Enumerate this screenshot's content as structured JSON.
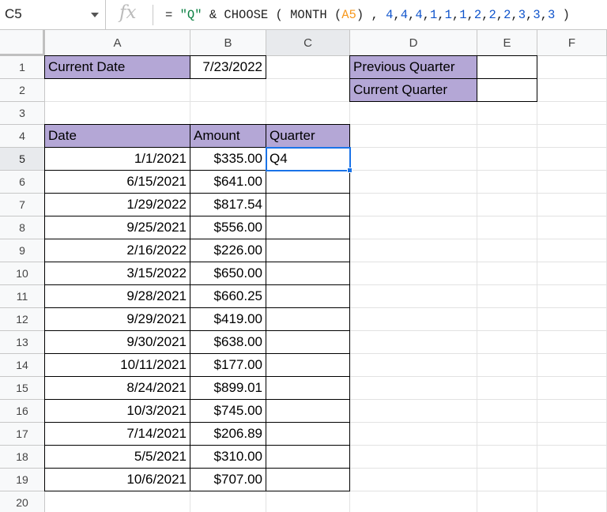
{
  "name_box": "C5",
  "formula_parts": [
    {
      "t": "= ",
      "c": ""
    },
    {
      "t": "\"Q\"",
      "c": "f-str"
    },
    {
      "t": " & CHOOSE ( MONTH (",
      "c": ""
    },
    {
      "t": "A5",
      "c": "f-ref"
    },
    {
      "t": ") , ",
      "c": ""
    },
    {
      "t": "4",
      "c": "f-num"
    },
    {
      "t": ",",
      "c": ""
    },
    {
      "t": "4",
      "c": "f-num"
    },
    {
      "t": ",",
      "c": ""
    },
    {
      "t": "4",
      "c": "f-num"
    },
    {
      "t": ",",
      "c": ""
    },
    {
      "t": "1",
      "c": "f-num"
    },
    {
      "t": ",",
      "c": ""
    },
    {
      "t": "1",
      "c": "f-num"
    },
    {
      "t": ",",
      "c": ""
    },
    {
      "t": "1",
      "c": "f-num"
    },
    {
      "t": ",",
      "c": ""
    },
    {
      "t": "2",
      "c": "f-num"
    },
    {
      "t": ",",
      "c": ""
    },
    {
      "t": "2",
      "c": "f-num"
    },
    {
      "t": ",",
      "c": ""
    },
    {
      "t": "2",
      "c": "f-num"
    },
    {
      "t": ",",
      "c": ""
    },
    {
      "t": "3",
      "c": "f-num"
    },
    {
      "t": ",",
      "c": ""
    },
    {
      "t": "3",
      "c": "f-num"
    },
    {
      "t": ",",
      "c": ""
    },
    {
      "t": "3",
      "c": "f-num"
    },
    {
      "t": " )",
      "c": ""
    }
  ],
  "columns": [
    "A",
    "B",
    "C",
    "D",
    "E",
    "F"
  ],
  "row_numbers": [
    "1",
    "2",
    "3",
    "4",
    "5",
    "6",
    "7",
    "8",
    "9",
    "10",
    "11",
    "12",
    "13",
    "14",
    "15",
    "16",
    "17",
    "18",
    "19",
    "20"
  ],
  "selected_column": "C",
  "selected_row": "5",
  "labels": {
    "current_date_label": "Current Date",
    "current_date_value": "7/23/2022",
    "previous_quarter": "Previous Quarter",
    "current_quarter": "Current Quarter"
  },
  "table": {
    "headers": [
      "Date",
      "Amount",
      "Quarter"
    ],
    "rows": [
      [
        "1/1/2021",
        "$335.00",
        "Q4"
      ],
      [
        "6/15/2021",
        "$641.00",
        ""
      ],
      [
        "1/29/2022",
        "$817.54",
        ""
      ],
      [
        "9/25/2021",
        "$556.00",
        ""
      ],
      [
        "2/16/2022",
        "$226.00",
        ""
      ],
      [
        "3/15/2022",
        "$650.00",
        ""
      ],
      [
        "9/28/2021",
        "$660.25",
        ""
      ],
      [
        "9/29/2021",
        "$419.00",
        ""
      ],
      [
        "9/30/2021",
        "$638.00",
        ""
      ],
      [
        "10/11/2021",
        "$177.00",
        ""
      ],
      [
        "8/24/2021",
        "$899.01",
        ""
      ],
      [
        "10/3/2021",
        "$745.00",
        ""
      ],
      [
        "7/14/2021",
        "$206.89",
        ""
      ],
      [
        "5/5/2021",
        "$310.00",
        ""
      ],
      [
        "10/6/2021",
        "$707.00",
        ""
      ]
    ]
  },
  "colors": {
    "header_fill": "#b4a7d6",
    "selection": "#1a73e8"
  }
}
